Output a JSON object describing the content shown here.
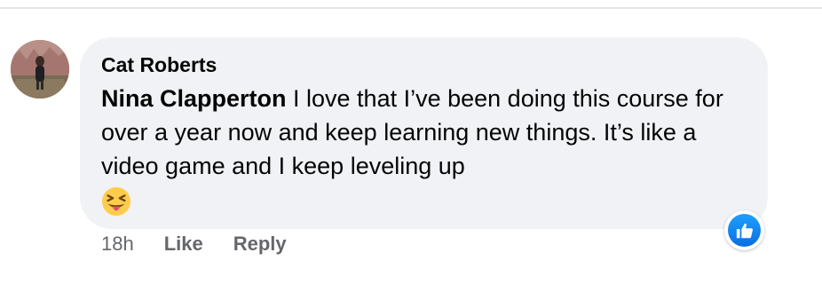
{
  "comment": {
    "author": "Cat Roberts",
    "mention": "Nina Clapperton",
    "text": " I love that I’ve been doing this course for over a year now and keep learning new things. It’s like a video game and I keep leveling up",
    "emoji": "squinting-face-with-tongue",
    "reaction_icon": "like-icon",
    "reaction_color": "#1877f2"
  },
  "actions": {
    "time": "18h",
    "like": "Like",
    "reply": "Reply"
  },
  "colors": {
    "bubble": "#f0f2f5",
    "secondary_text": "#65676b"
  }
}
